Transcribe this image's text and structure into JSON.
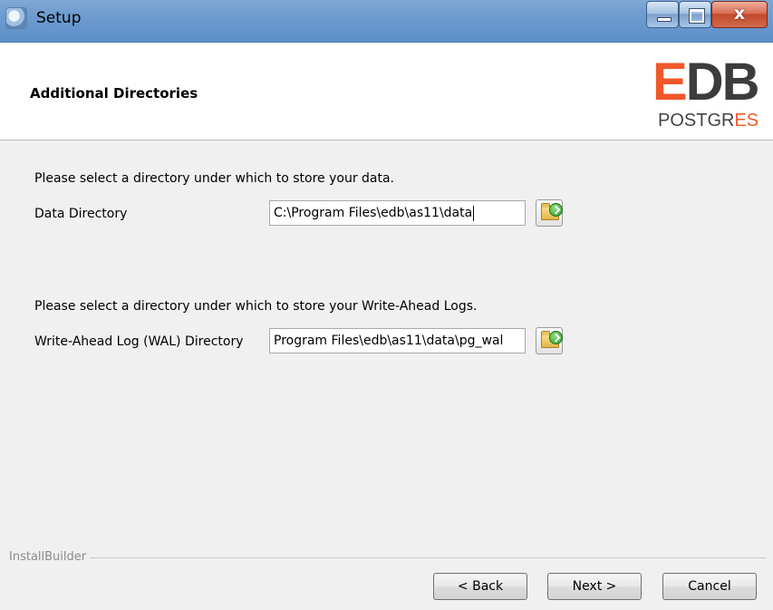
{
  "window": {
    "title": "Setup",
    "close_glyph": "x"
  },
  "header": {
    "title": "Additional Directories",
    "logo": {
      "edb_e": "E",
      "edb_db": "DB",
      "postgres_main": "POSTGR",
      "postgres_accent": "ES"
    }
  },
  "main": {
    "data_section": {
      "prompt": "Please select a directory under which to store your data.",
      "label": "Data Directory",
      "value": "C:\\Program Files\\edb\\as11\\data"
    },
    "wal_section": {
      "prompt": "Please select a directory under which to store your Write-Ahead Logs.",
      "label": "Write-Ahead Log (WAL) Directory",
      "value": "Program Files\\edb\\as11\\data\\pg_wal"
    }
  },
  "footer": {
    "brand": "InstallBuilder",
    "back_label": "< Back",
    "next_label": "Next >",
    "cancel_label": "Cancel"
  },
  "colors": {
    "accent": "#f0582a",
    "titlebar": "#6d9bcf"
  }
}
